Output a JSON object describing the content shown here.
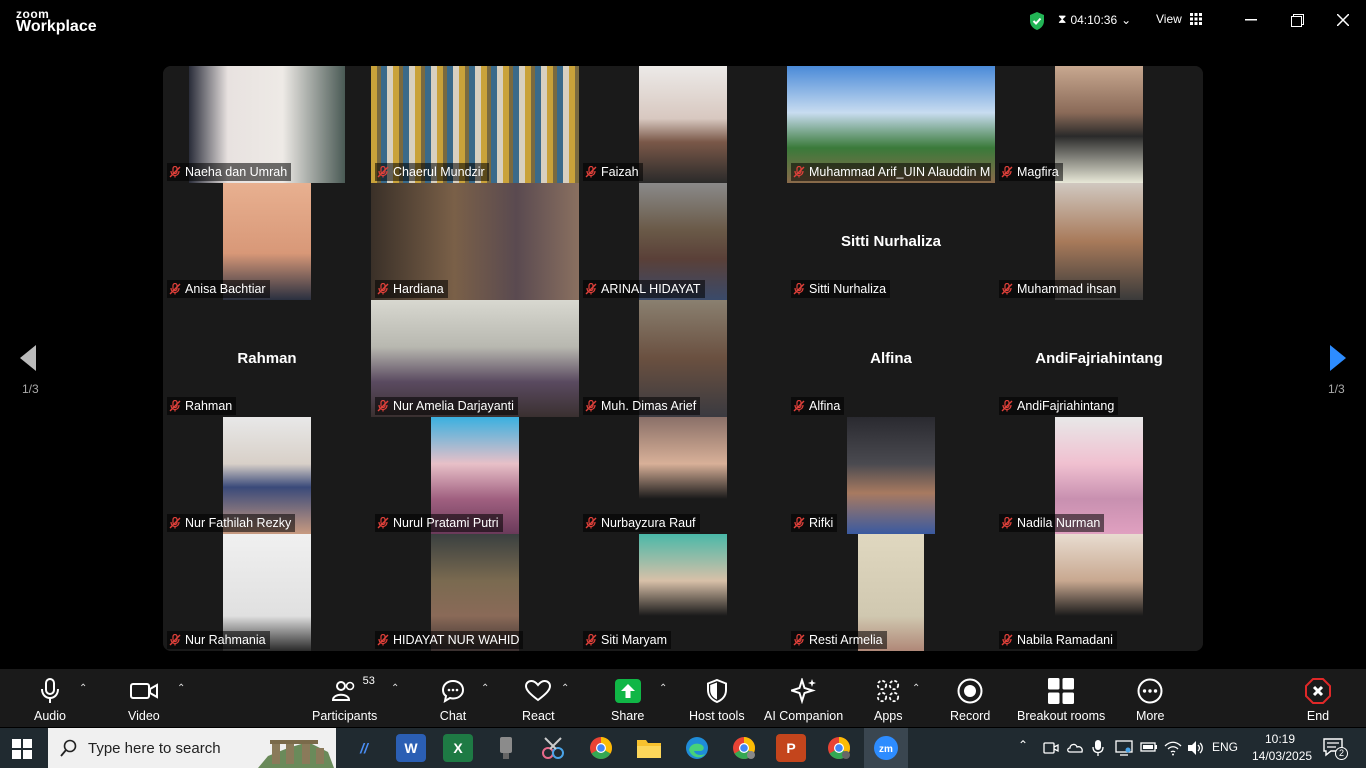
{
  "app": {
    "brand_small": "zoom",
    "brand": "Workplace"
  },
  "header": {
    "meeting_timer": "04:10:36",
    "view_label": "View"
  },
  "colors": {
    "active_speaker": "#2ecc71",
    "end_red": "#e02828",
    "share_green": "#10b646",
    "mute_red": "#e0403a"
  },
  "pagination": {
    "left": "1/3",
    "right": "1/3"
  },
  "participants": [
    {
      "name": "Naeha dan Umrah",
      "video": true
    },
    {
      "name": "Chaerul Mundzir",
      "video": true,
      "active": true
    },
    {
      "name": "Faizah",
      "video": true
    },
    {
      "name": "Muhammad Arif_UIN Alauddin M...",
      "video": true
    },
    {
      "name": "Magfira",
      "video": true
    },
    {
      "name": "Anisa Bachtiar",
      "video": true
    },
    {
      "name": "Hardiana",
      "video": true
    },
    {
      "name": "ARINAL HIDAYAT",
      "video": true
    },
    {
      "name": "Sitti Nurhaliza",
      "video": false,
      "card": "Sitti Nurhaliza"
    },
    {
      "name": "Muhammad ihsan",
      "video": true
    },
    {
      "name": "Rahman",
      "video": false,
      "card": "Rahman"
    },
    {
      "name": "Nur Amelia Darjayanti",
      "video": true
    },
    {
      "name": "Muh. Dimas Arief",
      "video": true
    },
    {
      "name": "Alfina",
      "video": false,
      "card": "Alfina"
    },
    {
      "name": "AndiFajriahintang",
      "video": false,
      "card": "AndiFajriahintang"
    },
    {
      "name": "Nur Fathilah Rezky",
      "video": true
    },
    {
      "name": "Nurul Pratami Putri",
      "video": true
    },
    {
      "name": "Nurbayzura Rauf",
      "video": true
    },
    {
      "name": "Rifki",
      "video": true
    },
    {
      "name": "Nadila Nurman",
      "video": true
    },
    {
      "name": "Nur Rahmania",
      "video": true
    },
    {
      "name": "HIDAYAT NUR WAHID",
      "video": true
    },
    {
      "name": "Siti Maryam",
      "video": true
    },
    {
      "name": "Resti Armelia",
      "video": true
    },
    {
      "name": "Nabila Ramadani",
      "video": true
    }
  ],
  "toolbar": {
    "audio": "Audio",
    "video": "Video",
    "participants": "Participants",
    "participants_count": "53",
    "chat": "Chat",
    "react": "React",
    "share": "Share",
    "host_tools": "Host tools",
    "ai_companion": "AI Companion",
    "apps": "Apps",
    "record": "Record",
    "breakout": "Breakout rooms",
    "more": "More",
    "end": "End"
  },
  "taskbar": {
    "search_placeholder": "Type here to search",
    "apps": [
      "Word",
      "Excel",
      "File Explorer",
      "Edge",
      "Chrome",
      "PowerPoint",
      "Zoom"
    ],
    "lang": "ENG",
    "time": "10:19",
    "date": "14/03/2025",
    "notifications": "2"
  }
}
